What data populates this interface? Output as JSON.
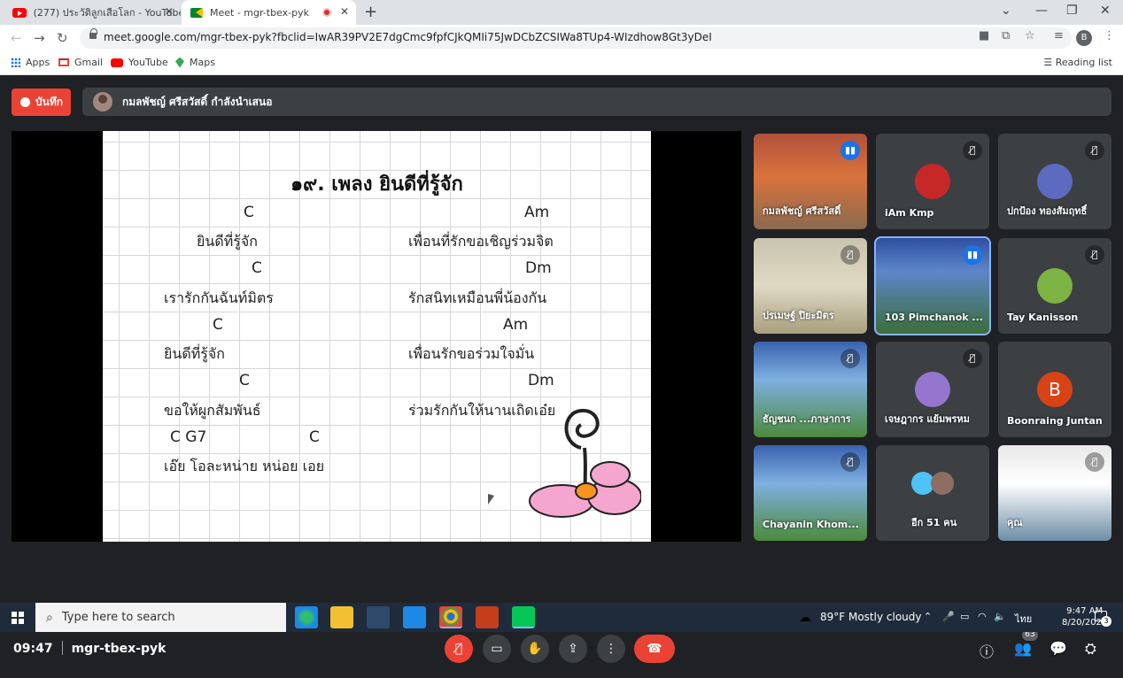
{
  "browser": {
    "tabs": [
      {
        "title": "(277) ประวัติลูกเสือโลก - YouTube"
      },
      {
        "title": "Meet - mgr-tbex-pyk"
      }
    ],
    "url": "meet.google.com/mgr-tbex-pyk?fbclid=IwAR39PV2E7dgCmc9fpfCJkQMIi75JwDCbZCSIWa8TUp4-WIzdhow8Gt3yDeI",
    "profile_initial": "B",
    "bookmarks": [
      "Apps",
      "Gmail",
      "YouTube",
      "Maps"
    ],
    "reading_list": "Reading list"
  },
  "meet": {
    "record_label": "บันทึก",
    "presenting_text": "กมลพัชญ์ ศรีสวัสดิ์ กำลังนำเสนอ",
    "slide": {
      "title": "๑๙. เพลง ยินดีที่รู้จัก",
      "chords_left": [
        "C",
        "C",
        "C",
        "C",
        "C  G7",
        "C"
      ],
      "lyrics_left": [
        "ยินดีที่รู้จัก",
        "เรารักกันฉันท์มิตร",
        "ยินดีที่รู้จัก",
        "ขอให้ผูกสัมพันธ์",
        "เอ๊ย โอละหน่าย หน่อย เอย"
      ],
      "chords_right": [
        "Am",
        "Dm",
        "Am",
        "Dm"
      ],
      "lyrics_right": [
        "เพื่อนที่รักขอเชิญร่วมจิต",
        "รักสนิทเหมือนพี่น้องกัน",
        "เพื่อนรักขอร่วมใจมั่น",
        "ร่วมรักกันให้นานเถิดเอ๋ย"
      ]
    },
    "participants": [
      {
        "name": "กมลพัชญ์ ศรีสวัสดิ์"
      },
      {
        "name": "iAm Kmp"
      },
      {
        "name": "ปกป้อง ทองสัมฤทธิ์"
      },
      {
        "name": "ปรเมษฐ์ ปิยะมิตร"
      },
      {
        "name": "103 Pimchanok ..."
      },
      {
        "name": "Tay Kanisson"
      },
      {
        "name": "ธัญชนก ...ภาษาการ"
      },
      {
        "name": "เจษฎากร แย้มพรหม"
      },
      {
        "name": "Boonraing Juntan",
        "initial": "B"
      },
      {
        "name": "Chayanin Khom..."
      },
      {
        "name": "อีก 51 คน"
      },
      {
        "name": "คุณ"
      }
    ],
    "time": "09:47",
    "meeting_code": "mgr-tbex-pyk",
    "people_count": "63"
  },
  "taskbar": {
    "search_placeholder": "Type here to search",
    "weather": "89°F  Mostly cloudy",
    "language": "ไทย",
    "time": "9:47 AM",
    "date": "8/20/2021",
    "notifications": "3"
  },
  "colors": {
    "meet_bg": "#202124",
    "end_call": "#ea4335",
    "record": "#ea4335",
    "accent": "#1a73e8"
  }
}
